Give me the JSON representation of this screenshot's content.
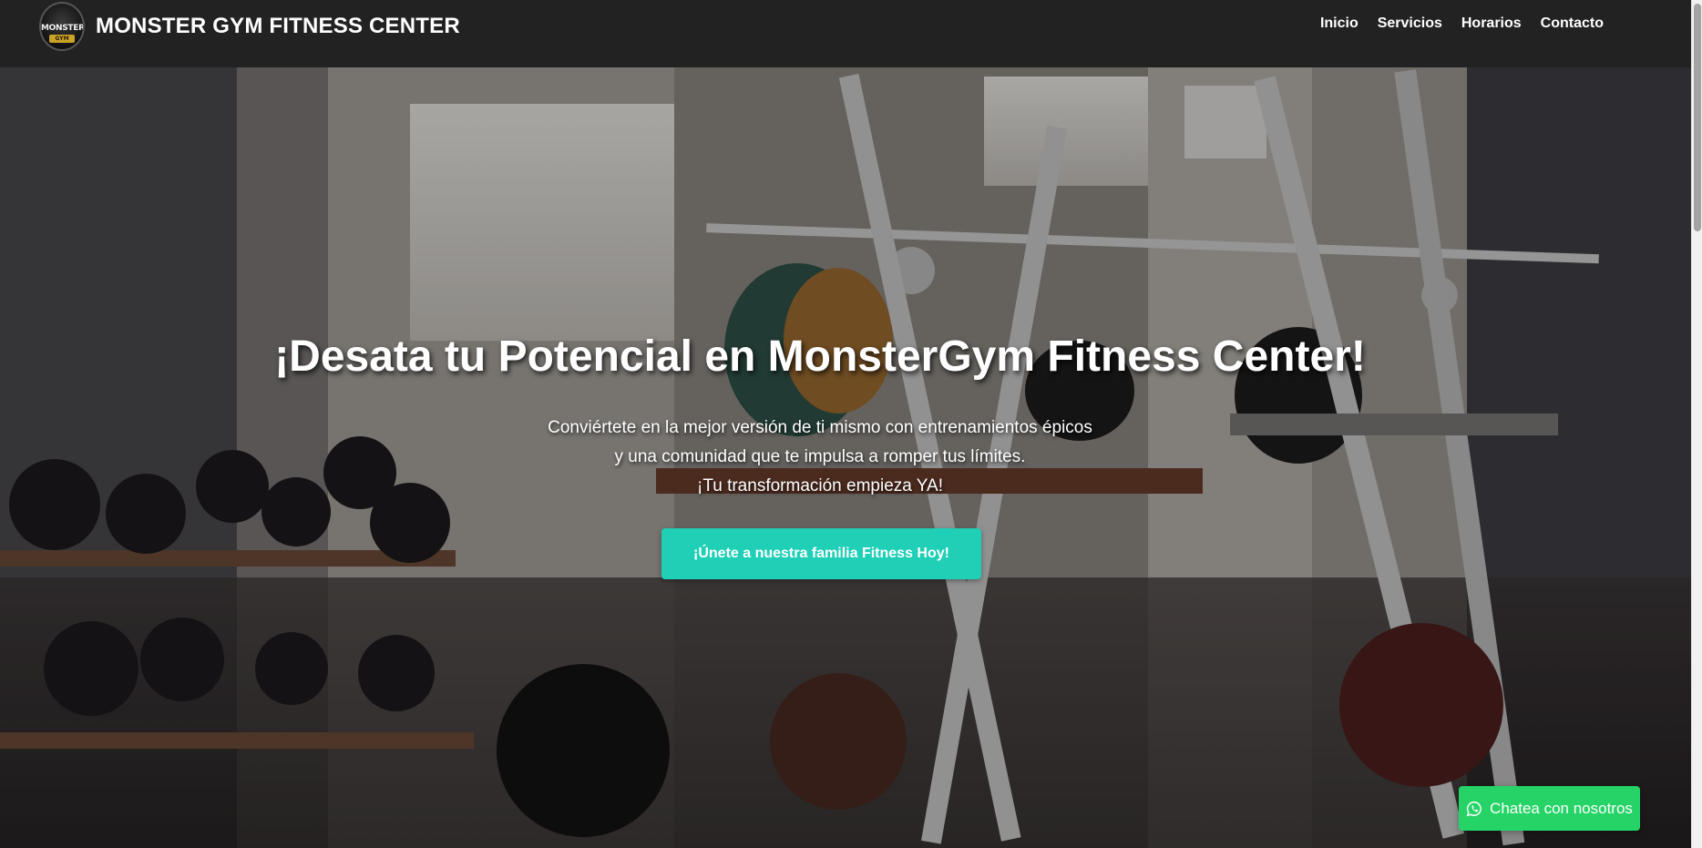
{
  "header": {
    "brand_title": "MONSTER GYM FITNESS CENTER",
    "logo_word": "MONSTER",
    "logo_sub": "GYM",
    "nav": [
      {
        "label": "Inicio"
      },
      {
        "label": "Servicios"
      },
      {
        "label": "Horarios"
      },
      {
        "label": "Contacto"
      }
    ]
  },
  "hero": {
    "title": "¡Desata tu Potencial en MonsterGym Fitness Center!",
    "subtitle_lines": [
      "Conviértete en la mejor versión de ti mismo con entrenamientos épicos",
      "y una comunidad que te impulsa a romper tus límites.",
      "¡Tu transformación empieza YA!"
    ],
    "cta_label": "¡Únete a nuestra familia Fitness Hoy!"
  },
  "chat": {
    "label": "Chatea con nosotros",
    "icon": "whatsapp-icon"
  },
  "colors": {
    "navbar_bg": "#222222",
    "cta_bg": "#1fcfb6",
    "chat_bg": "#25d366",
    "text": "#ffffff"
  }
}
